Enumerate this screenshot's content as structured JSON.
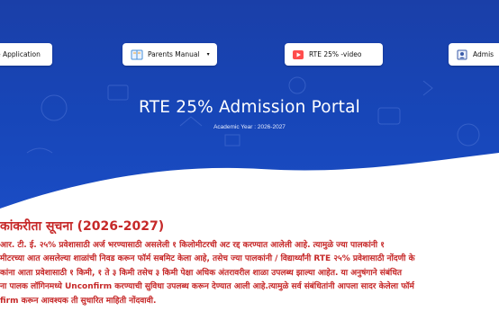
{
  "nav": {
    "apply": {
      "label": "e Application"
    },
    "manual": {
      "label": "Parents Manual",
      "caret": "▾"
    },
    "video": {
      "label": "RTE 25% -video"
    },
    "admission": {
      "label": "Admis"
    }
  },
  "hero": {
    "title": "RTE 25% Admission Portal",
    "academic_year": "Academic Year : 2026-2027"
  },
  "notice": {
    "title": "कांकरीता सूचना (2026-2027)",
    "lines": [
      "आर. टी. ई. २५% प्रवेशासाठी अर्ज भरण्यासाठी असलेली १ किलोमीटरची अट रद्द करण्यात आलेली आहे. त्यामुळे ज्या पालकांनी १",
      "मीटरच्या आत असलेल्या शाळांची निवड करून फॉर्म सबमिट केला आहे, तसेच ज्या पालकांनी / विद्यार्थ्यांनी RTE २५% प्रवेशासाठी नोंदणी के",
      "कांना आता प्रवेशासाठी १ किमी, १ ते ३ किमी तसेच ३ किमी पेक्षा अधिक अंतरावरील शाळा उपलब्ध झाल्या आहेत. या अनुषंगाने संबंधित",
      "ना पालक लॉगिनमध्ये Unconfirm करण्याची सुविधा उपलब्ध करून देण्यात आली आहे.त्यामुळे सर्व संबंधितांनी आपला सादर केलेला फॉर्म",
      "firm करून आवश्यक ती सुधारित माहिती नोंदवावी."
    ]
  },
  "colors": {
    "hero_blue": "#1746b8",
    "notice_red": "#c62828"
  },
  "icons": [
    "manual-icon",
    "video-icon",
    "admission-icon"
  ]
}
